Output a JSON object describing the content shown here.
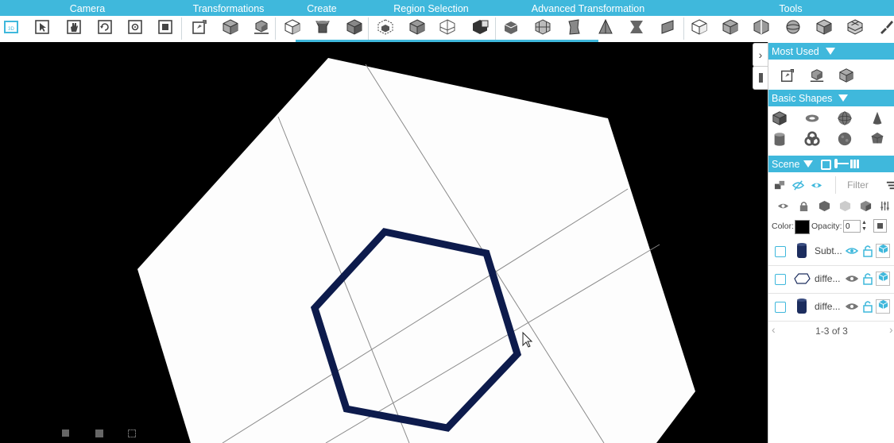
{
  "toolbar": {
    "groups": [
      {
        "label": "Camera"
      },
      {
        "label": "Transformations"
      },
      {
        "label": "Create"
      },
      {
        "label": "Region Selection"
      },
      {
        "label": "Advanced Transformation"
      },
      {
        "label": "Tools"
      }
    ],
    "buttons": [
      "view-3d-icon",
      "select-pointer-icon",
      "pan-hand-icon",
      "rotate-view-icon",
      "focus-icon",
      "frame-icon",
      "transform-icon",
      "cube-icon",
      "move-cube-icon",
      "box-create-icon",
      "extrude-icon",
      "cube-solid-icon",
      "region-cube-icon",
      "region-box-icon",
      "region-plane-icon",
      "region-partial-icon",
      "bevel-icon",
      "mesh-icon",
      "twist-icon",
      "taper-icon",
      "bend-icon",
      "plane-shape-icon",
      "wireframe-cube-icon",
      "solid-cube-icon",
      "split-cube-icon",
      "sphere-tool-icon",
      "cube-shaded-icon",
      "grid-cube-icon",
      "brush-tool-icon"
    ],
    "accent": "#3fb8dc"
  },
  "viewport": {
    "background": "#000000",
    "plane_color": "#ffffff",
    "shape_color": "#0d1b4c"
  },
  "panel": {
    "most_used": {
      "title": "Most Used",
      "icons": [
        "transform-icon",
        "move-cube-icon",
        "cube-icon"
      ]
    },
    "basic_shapes": {
      "title": "Basic Shapes",
      "icons": [
        "cube-shape-icon",
        "torus-shape-icon",
        "sphere-shape-icon",
        "cone-shape-icon",
        "cylinder-shape-icon",
        "knot-shape-icon",
        "sphere-rough-icon",
        "gem-shape-icon"
      ]
    },
    "scene": {
      "title": "Scene",
      "filter_placeholder": "Filter",
      "color_label": "Color:",
      "opacity_label": "Opacity:",
      "opacity_value": "0",
      "color_value": "#000000",
      "objects": [
        {
          "name": "Subt...",
          "thumb": "cylinder"
        },
        {
          "name": "diffe...",
          "thumb": "hexagon"
        },
        {
          "name": "diffe...",
          "thumb": "cylinder"
        }
      ],
      "pager": "1-3 of 3"
    }
  }
}
